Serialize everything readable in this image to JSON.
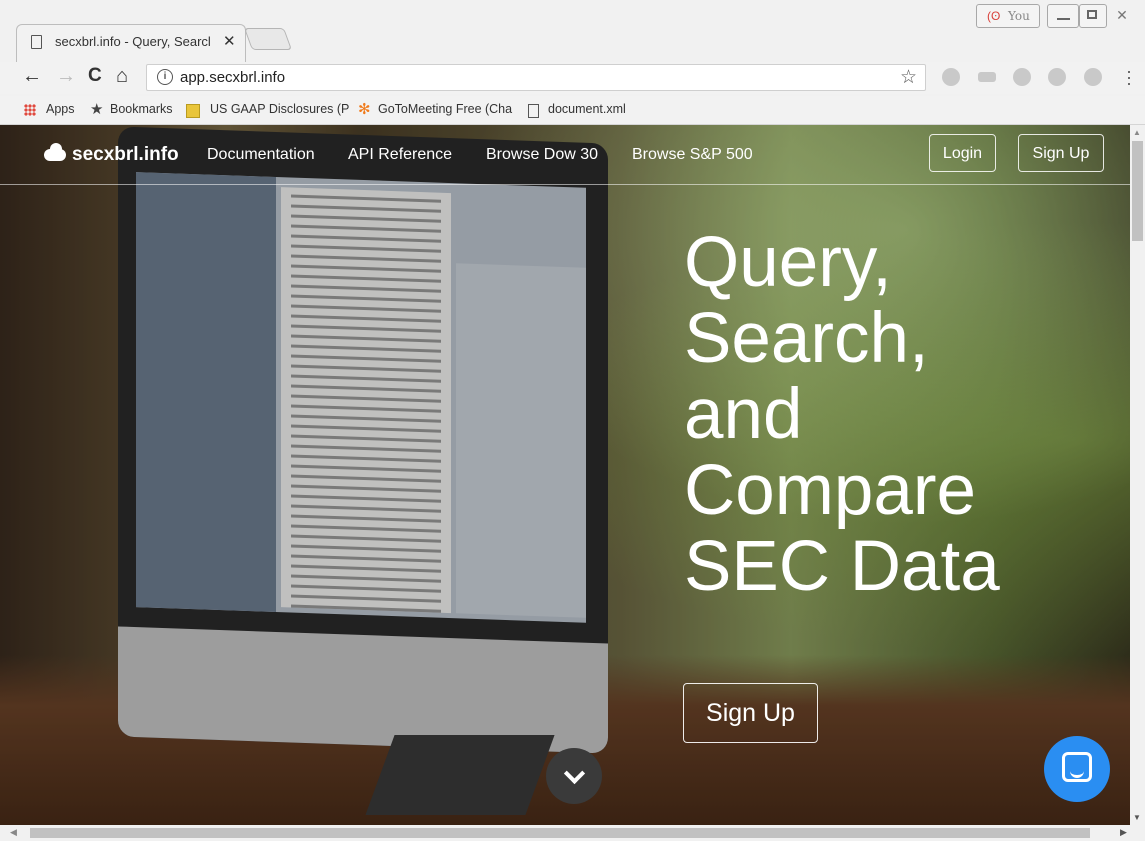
{
  "window": {
    "tab_title": "secxbrl.info - Query, Searcl",
    "tab_close": "✕",
    "profile_label": "You"
  },
  "toolbar": {
    "url": "app.secxbrl.info",
    "back": "←",
    "forward": "→",
    "reload": "C",
    "home": "⌂",
    "star": "☆"
  },
  "bookmarks": [
    {
      "label": "Apps"
    },
    {
      "label": "Bookmarks"
    },
    {
      "label": "US GAAP Disclosures (P"
    },
    {
      "label": "GoToMeeting Free (Cha"
    },
    {
      "label": "document.xml"
    }
  ],
  "site": {
    "brand": "secxbrl.info",
    "nav": [
      "Documentation",
      "API Reference",
      "Browse Dow 30",
      "Browse S&P 500"
    ],
    "login": "Login",
    "signup": "Sign Up"
  },
  "hero": {
    "title_lines": [
      "Query,",
      "Search,",
      "and",
      "Compare",
      "SEC Data"
    ],
    "cta": "Sign Up"
  },
  "colors": {
    "chat_button": "#2a8ef2",
    "apps_icon": "#e0483d"
  },
  "icons": [
    "page-icon",
    "info-icon",
    "star-icon",
    "cloud-icon",
    "chevron-down-icon",
    "chat-icon"
  ]
}
